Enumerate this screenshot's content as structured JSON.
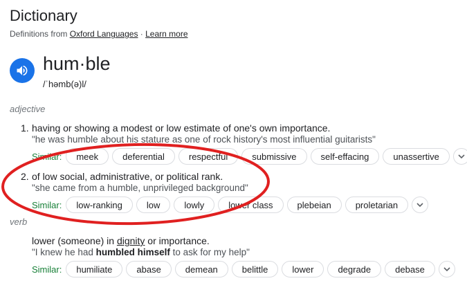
{
  "header": {
    "title": "Dictionary",
    "source_prefix": "Definitions from ",
    "source_link": "Oxford Languages",
    "separator": " · ",
    "learn_more": "Learn more"
  },
  "entry": {
    "word": "hum·ble",
    "phonetic": "/ˈhəmb(ə)l/"
  },
  "adjective": {
    "pos": "adjective",
    "senses": [
      {
        "num": "1.",
        "definition": "having or showing a modest or low estimate of one's own importance.",
        "example": "\"he was humble about his stature as one of rock history's most influential guitarists\"",
        "similar_label": "Similar:",
        "similar": [
          "meek",
          "deferential",
          "respectful",
          "submissive",
          "self-effacing",
          "unassertive"
        ]
      },
      {
        "num": "2.",
        "definition": "of low social, administrative, or political rank.",
        "example": "\"she came from a humble, unprivileged background\"",
        "similar_label": "Similar:",
        "similar": [
          "low-ranking",
          "low",
          "lowly",
          "lower class",
          "plebeian",
          "proletarian"
        ]
      }
    ]
  },
  "verb": {
    "pos": "verb",
    "def_pre": "lower (someone) in ",
    "def_link": "dignity",
    "def_post": " or importance.",
    "ex_pre": "\"I knew he had ",
    "ex_bold": "humbled himself",
    "ex_post": " to ask for my help\"",
    "similar_label": "Similar:",
    "similar": [
      "humiliate",
      "abase",
      "demean",
      "belittle",
      "lower",
      "degrade",
      "debase"
    ]
  },
  "colors": {
    "accent": "#1a73e8",
    "similar_label": "#188038",
    "annotation": "#e02020"
  },
  "icons": {
    "speaker": "speaker-icon",
    "expand": "chevron-down-icon"
  }
}
